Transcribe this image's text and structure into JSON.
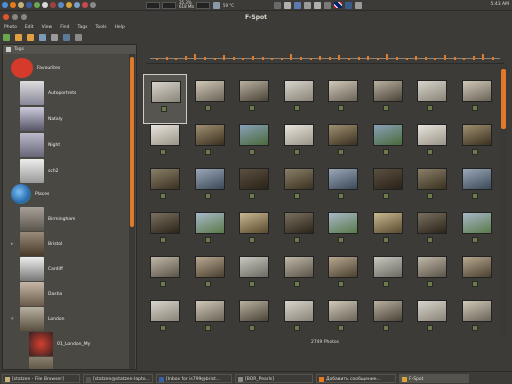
{
  "top_panel": {
    "cpu_text": "35.3%",
    "mem_text": "618 Mb",
    "weather_text": "59 °C",
    "clock": "5:43 AM"
  },
  "window": {
    "title": "F-Spot"
  },
  "menu": [
    "Photo",
    "Edit",
    "View",
    "Find",
    "Tags",
    "Tools",
    "Help"
  ],
  "sidebar": {
    "header": "Tags",
    "tags": [
      {
        "label": "Favourites",
        "icon": "heart-icon"
      },
      {
        "label": "Autoportrets"
      },
      {
        "label": "Nataly"
      },
      {
        "label": "Night"
      },
      {
        "label": "sch2"
      },
      {
        "label": "Places",
        "icon": "globe-icon"
      },
      {
        "label": "Birmingham"
      },
      {
        "label": "Bristol"
      },
      {
        "label": "Cardiff"
      },
      {
        "label": "Dasha"
      },
      {
        "label": "London"
      },
      {
        "label": "01_London_My"
      }
    ]
  },
  "gallery": {
    "count_text": "2749 Photos"
  },
  "taskbar": [
    {
      "label": "[statzen - File Browser]"
    },
    {
      "label": "[statzen@statzen-lapto..."
    },
    {
      "label": "[Inbox for is799@brist..."
    },
    {
      "label": "[BOR_Pearls]"
    },
    {
      "label": "Добавить сообщение..."
    },
    {
      "label": "F-Spot",
      "active": true
    }
  ],
  "colors": {
    "accent": "#e07a2a",
    "panel": "#3c3b37",
    "sidebar": "#4a4843"
  }
}
